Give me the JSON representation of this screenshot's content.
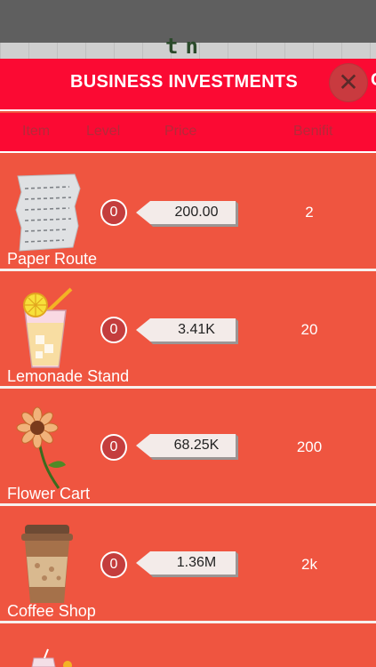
{
  "status_bar": {
    "lcd_text": "tn"
  },
  "header": {
    "title": "BUSINESS INVESTMENTS",
    "close_symbol": "✕",
    "cut_off_text": "C"
  },
  "columns": {
    "item": "Item",
    "level": "Level",
    "price": "Price",
    "benefit": "Benifit"
  },
  "items": [
    {
      "name": "Paper Route",
      "level": "0",
      "price": "200.00",
      "benefit": "2",
      "icon": "paper-route-icon"
    },
    {
      "name": "Lemonade Stand",
      "level": "0",
      "price": "3.41K",
      "benefit": "20",
      "icon": "lemonade-icon"
    },
    {
      "name": "Flower Cart",
      "level": "0",
      "price": "68.25K",
      "benefit": "200",
      "icon": "flower-icon"
    },
    {
      "name": "Coffee Shop",
      "level": "0",
      "price": "1.36M",
      "benefit": "2k",
      "icon": "coffee-cup-icon"
    }
  ],
  "colors": {
    "header": "#fb0a33",
    "row_bg": "#ef5540",
    "column_text": "#b52a3a",
    "price_tag": "#f3ebe9"
  }
}
